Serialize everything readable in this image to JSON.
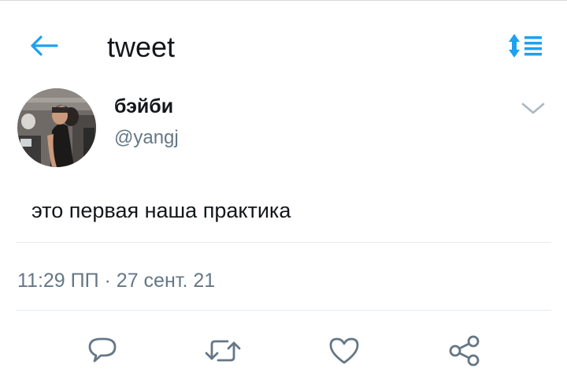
{
  "header": {
    "title": "tweet",
    "back_icon": "arrow-left-icon",
    "sort_icon": "sort-list-icon",
    "accent_color": "#1da1f2"
  },
  "tweet": {
    "author": {
      "display_name": "бэйби",
      "handle": "@yangj"
    },
    "text": "это первая наша практика",
    "timestamp": "11:29 ПП · 27 сент. 21"
  },
  "actions": [
    {
      "name": "reply",
      "icon": "reply-icon"
    },
    {
      "name": "retweet",
      "icon": "retweet-icon"
    },
    {
      "name": "like",
      "icon": "heart-icon"
    },
    {
      "name": "share",
      "icon": "share-icon"
    }
  ],
  "colors": {
    "text": "#14171a",
    "secondary": "#657786",
    "divider": "#e6ecf0"
  }
}
